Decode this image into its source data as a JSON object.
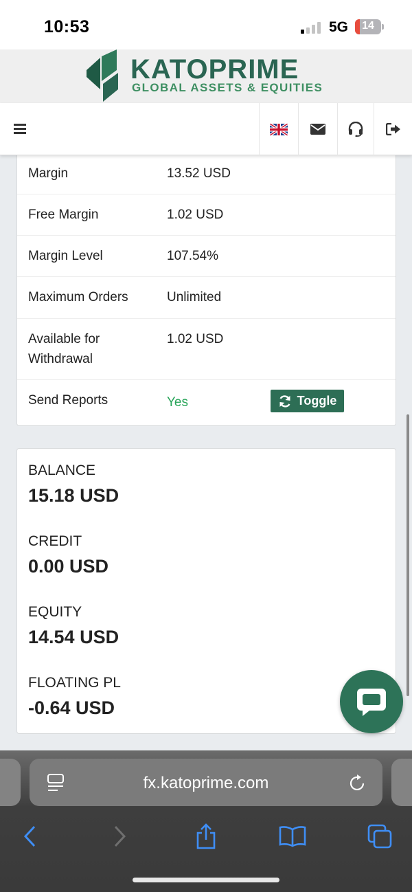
{
  "status_bar": {
    "time": "10:53",
    "network": "5G",
    "battery": "14"
  },
  "brand": {
    "name": "KATOPRIME",
    "tagline": "GLOBAL ASSETS & EQUITIES",
    "color_primary": "#2a6552",
    "color_secondary": "#3e8f62"
  },
  "nav": {
    "items": [
      {
        "icon": "uk-flag-icon"
      },
      {
        "icon": "envelope-icon"
      },
      {
        "icon": "headset-icon"
      },
      {
        "icon": "sign-out-icon"
      }
    ]
  },
  "account_table": {
    "rows": [
      {
        "label": "Margin",
        "value": "13.52 USD"
      },
      {
        "label": "Free Margin",
        "value": "1.02 USD"
      },
      {
        "label": "Margin Level",
        "value": "107.54%"
      },
      {
        "label": "Maximum Orders",
        "value": "Unlimited"
      },
      {
        "label_line1": "Available for",
        "label_line2": "Withdrawal",
        "value": "1.02 USD"
      },
      {
        "label": "Send Reports",
        "value": "Yes",
        "action": "Toggle"
      }
    ]
  },
  "summary": {
    "stats": [
      {
        "label": "BALANCE",
        "value": "15.18 USD"
      },
      {
        "label": "CREDIT",
        "value": "0.00 USD"
      },
      {
        "label": "EQUITY",
        "value": "14.54 USD"
      },
      {
        "label": "FLOATING PL",
        "value": "-0.64 USD"
      }
    ]
  },
  "browser": {
    "url": "fx.katoprime.com",
    "accent": "#3f8ef5"
  }
}
